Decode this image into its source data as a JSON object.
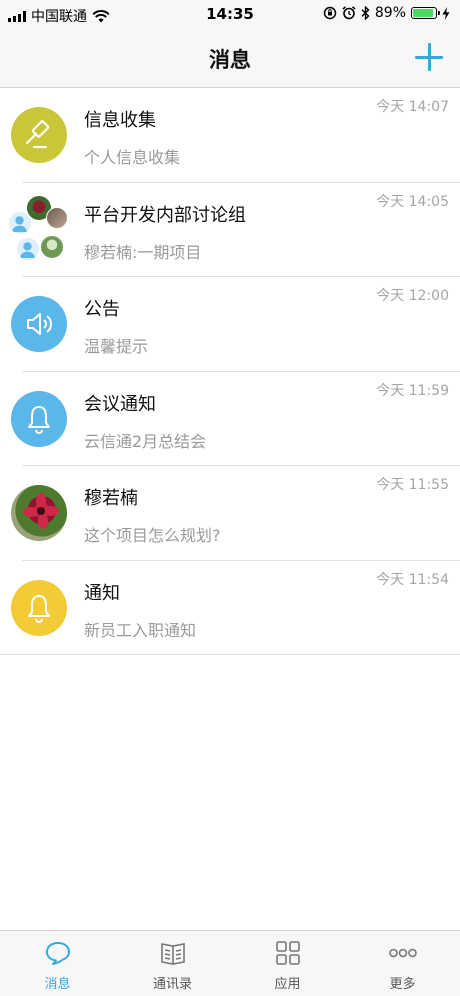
{
  "status_bar": {
    "carrier": "中国联通",
    "time": "14:35",
    "battery_percent": "89%",
    "battery_level": 0.89
  },
  "nav": {
    "title": "消息",
    "add_icon": "plus-icon"
  },
  "messages": [
    {
      "title": "信息收集",
      "subtitle": "个人信息收集",
      "time": "今天 14:07",
      "avatar": "gavel-icon",
      "color": "#c9c637"
    },
    {
      "title": "平台开发内部讨论组",
      "subtitle": "穆若楠:一期项目",
      "time": "今天 14:05",
      "avatar": "group-avatar"
    },
    {
      "title": "公告",
      "subtitle": "温馨提示",
      "time": "今天 12:00",
      "avatar": "speaker-icon",
      "color": "#5bb6ea"
    },
    {
      "title": "会议通知",
      "subtitle": "云信通2月总结会",
      "time": "今天 11:59",
      "avatar": "bell-icon",
      "color": "#5bb6ea"
    },
    {
      "title": "穆若楠",
      "subtitle": "这个项目怎么规划?",
      "time": "今天 11:55",
      "avatar": "flower-photo"
    },
    {
      "title": "通知",
      "subtitle": "新员工入职通知",
      "time": "今天 11:54",
      "avatar": "bell-icon",
      "color": "#f2cb36"
    }
  ],
  "tabs": [
    {
      "label": "消息",
      "icon": "chat-bubble-icon",
      "active": true
    },
    {
      "label": "通讯录",
      "icon": "address-book-icon",
      "active": false
    },
    {
      "label": "应用",
      "icon": "grid-icon",
      "active": false
    },
    {
      "label": "更多",
      "icon": "more-dots-icon",
      "active": false
    }
  ],
  "colors": {
    "accent": "#35a8e0",
    "secondary_text": "#9a9a9a",
    "divider": "#e2e2e2"
  }
}
